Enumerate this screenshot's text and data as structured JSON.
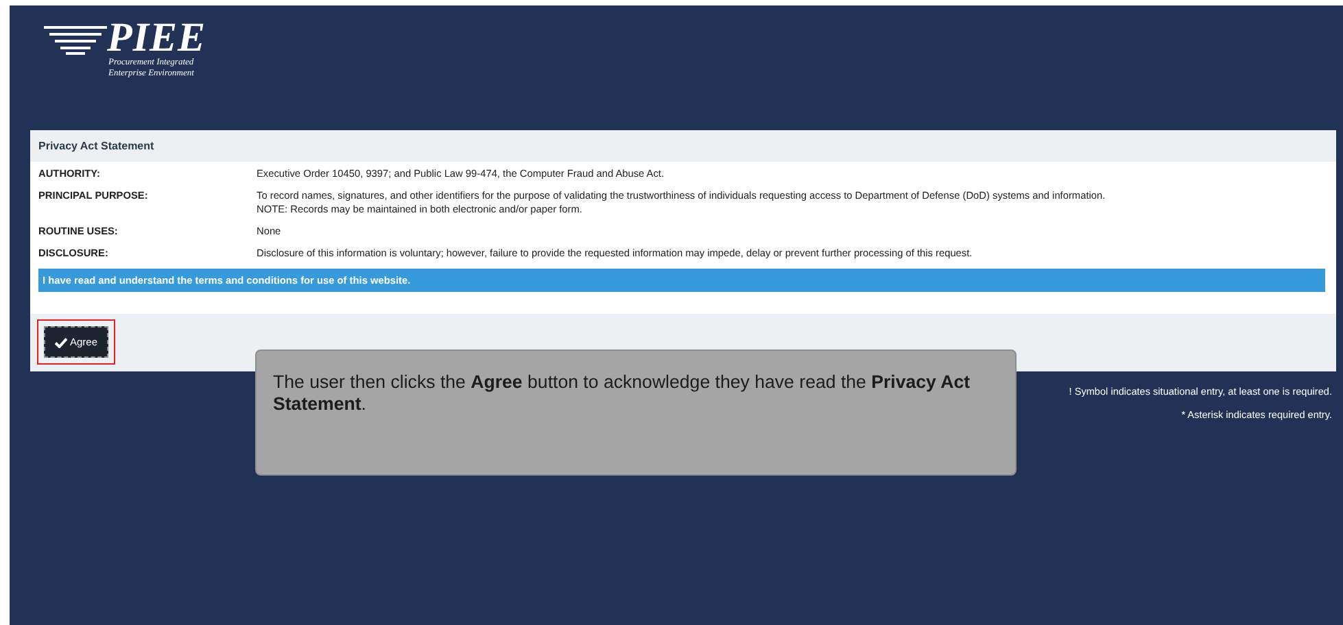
{
  "logo": {
    "title": "PIEE",
    "subtitle_lines": [
      "Procurement Integrated",
      "Enterprise Environment"
    ]
  },
  "panel": {
    "title": "Privacy Act Statement",
    "rows": [
      {
        "label": "AUTHORITY:",
        "value": "Executive Order 10450, 9397; and Public Law 99-474, the Computer Fraud and Abuse Act."
      },
      {
        "label": "PRINCIPAL PURPOSE:",
        "value": "To record names, signatures, and other identifiers for the purpose of validating the trustworthiness of individuals requesting access to Department of Defense (DoD) systems and information. NOTE: Records may be maintained in both electronic and/or paper form."
      },
      {
        "label": "ROUTINE USES:",
        "value": "None"
      },
      {
        "label": "DISCLOSURE:",
        "value": "Disclosure of this information is voluntary; however, failure to provide the requested information may impede, delay or prevent further processing of this request."
      }
    ],
    "notice": "I have read and understand the terms and conditions for use of this website.",
    "button": {
      "label": "Agree"
    }
  },
  "legend": [
    "! Symbol indicates situational entry, at least one is required.",
    "* Asterisk indicates required entry."
  ],
  "callout": {
    "text": "The user then clicks the **Agree** button to acknowledge they have read the **Privacy Act Statement**."
  }
}
